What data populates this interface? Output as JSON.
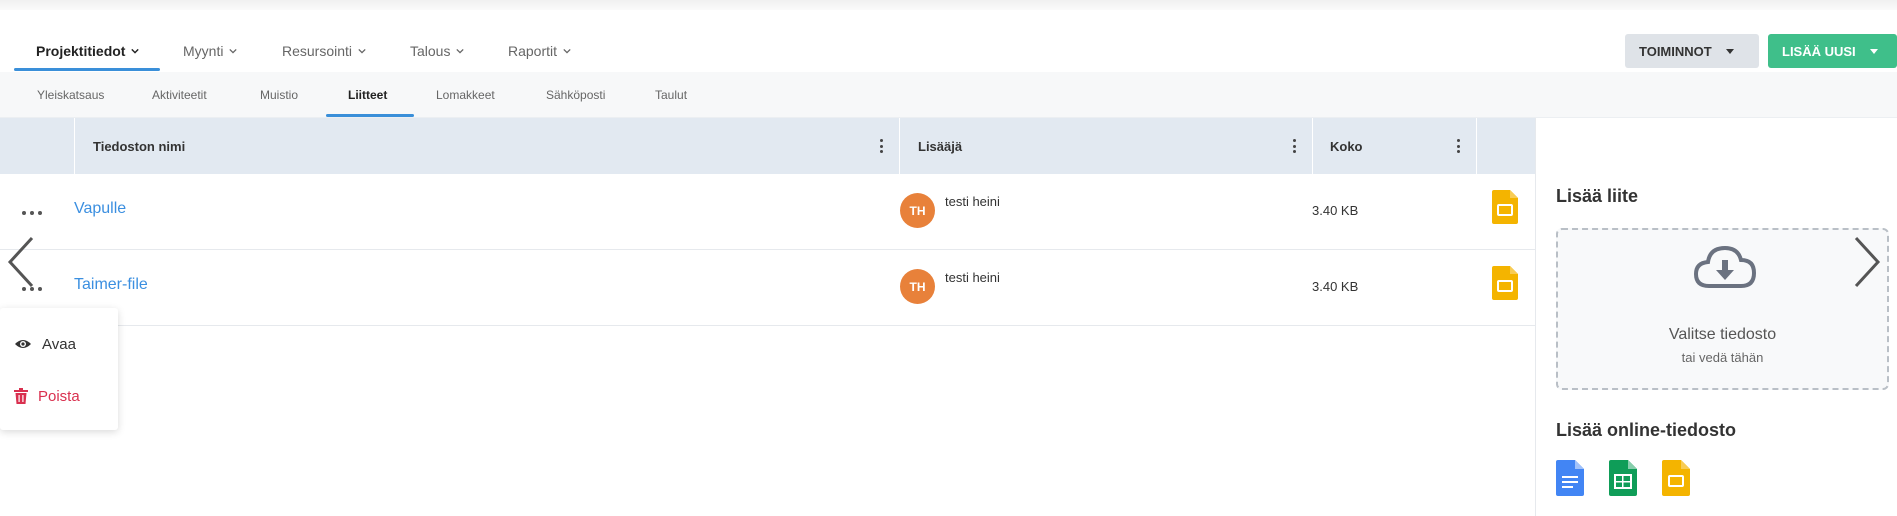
{
  "main_nav": {
    "items": [
      {
        "label": "Projektitiedot",
        "active": true
      },
      {
        "label": "Myynti",
        "active": false
      },
      {
        "label": "Resursointi",
        "active": false
      },
      {
        "label": "Talous",
        "active": false
      },
      {
        "label": "Raportit",
        "active": false
      }
    ],
    "actions_label": "TOIMINNOT",
    "add_new_label": "LISÄÄ UUSI"
  },
  "sub_tabs": {
    "items": [
      "Yleiskatsaus",
      "Aktiviteetit",
      "Muistio",
      "Liitteet",
      "Lomakkeet",
      "Sähköposti",
      "Taulut"
    ],
    "active": "Liitteet"
  },
  "table": {
    "headers": {
      "name": "Tiedoston nimi",
      "added_by": "Lisääjä",
      "size": "Koko"
    },
    "rows": [
      {
        "name": "Vapulle",
        "initials": "TH",
        "added_by": "testi heini",
        "size": "3.40 KB",
        "file_icon": "google-slides-icon"
      },
      {
        "name": "Taimer-file",
        "initials": "TH",
        "added_by": "testi heini",
        "size": "3.40 KB",
        "file_icon": "google-slides-icon"
      }
    ]
  },
  "context_menu": {
    "open_label": "Avaa",
    "delete_label": "Poista"
  },
  "attach_panel": {
    "title": "Lisää liite",
    "drop_title": "Valitse tiedosto",
    "drop_subtitle": "tai vedä tähän",
    "online_title": "Lisää online-tiedosto",
    "online_icons": [
      "google-docs-icon",
      "google-sheets-icon",
      "google-slides-icon"
    ]
  },
  "colors": {
    "accent_blue": "#3a8fd9",
    "link_blue": "#3b8fe0",
    "green_button": "#3fbf8a",
    "avatar_orange": "#e8813a",
    "delete_red": "#d9304f",
    "slides_yellow": "#f4b400",
    "docs_blue": "#4285f4",
    "sheets_green": "#0f9d58"
  }
}
